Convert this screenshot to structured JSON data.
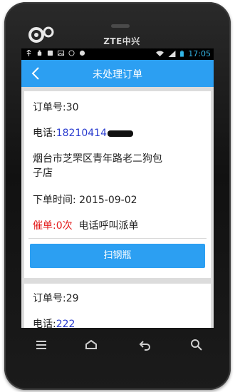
{
  "device": {
    "brand": "ZTE中兴"
  },
  "status_bar": {
    "time": "17:05"
  },
  "header": {
    "title": "未处理订单"
  },
  "orders": [
    {
      "order_label": "订单号:30",
      "phone_label": "电话:",
      "phone_value": "18210414",
      "address": "烟台市芝罘区青年路老二狗包子店",
      "address_line1": "烟台市芝罘区青年路老二狗包",
      "address_line2": "子店",
      "time_label": "下单时间: ",
      "time_value": "2015-09-02",
      "urge_text": "催单:0次",
      "dispatch_text": "电话呼叫派单",
      "button_label": "扫钢瓶"
    },
    {
      "order_label": "订单号:29",
      "phone_label": "电话:",
      "phone_value": "222"
    }
  ],
  "colors": {
    "accent": "#2c9ff2",
    "urge": "#e31b1b",
    "phone_link": "#2a3ccf"
  },
  "icons": [
    "back-arrow-icon",
    "menu-icon",
    "home-icon",
    "return-icon",
    "search-icon"
  ]
}
